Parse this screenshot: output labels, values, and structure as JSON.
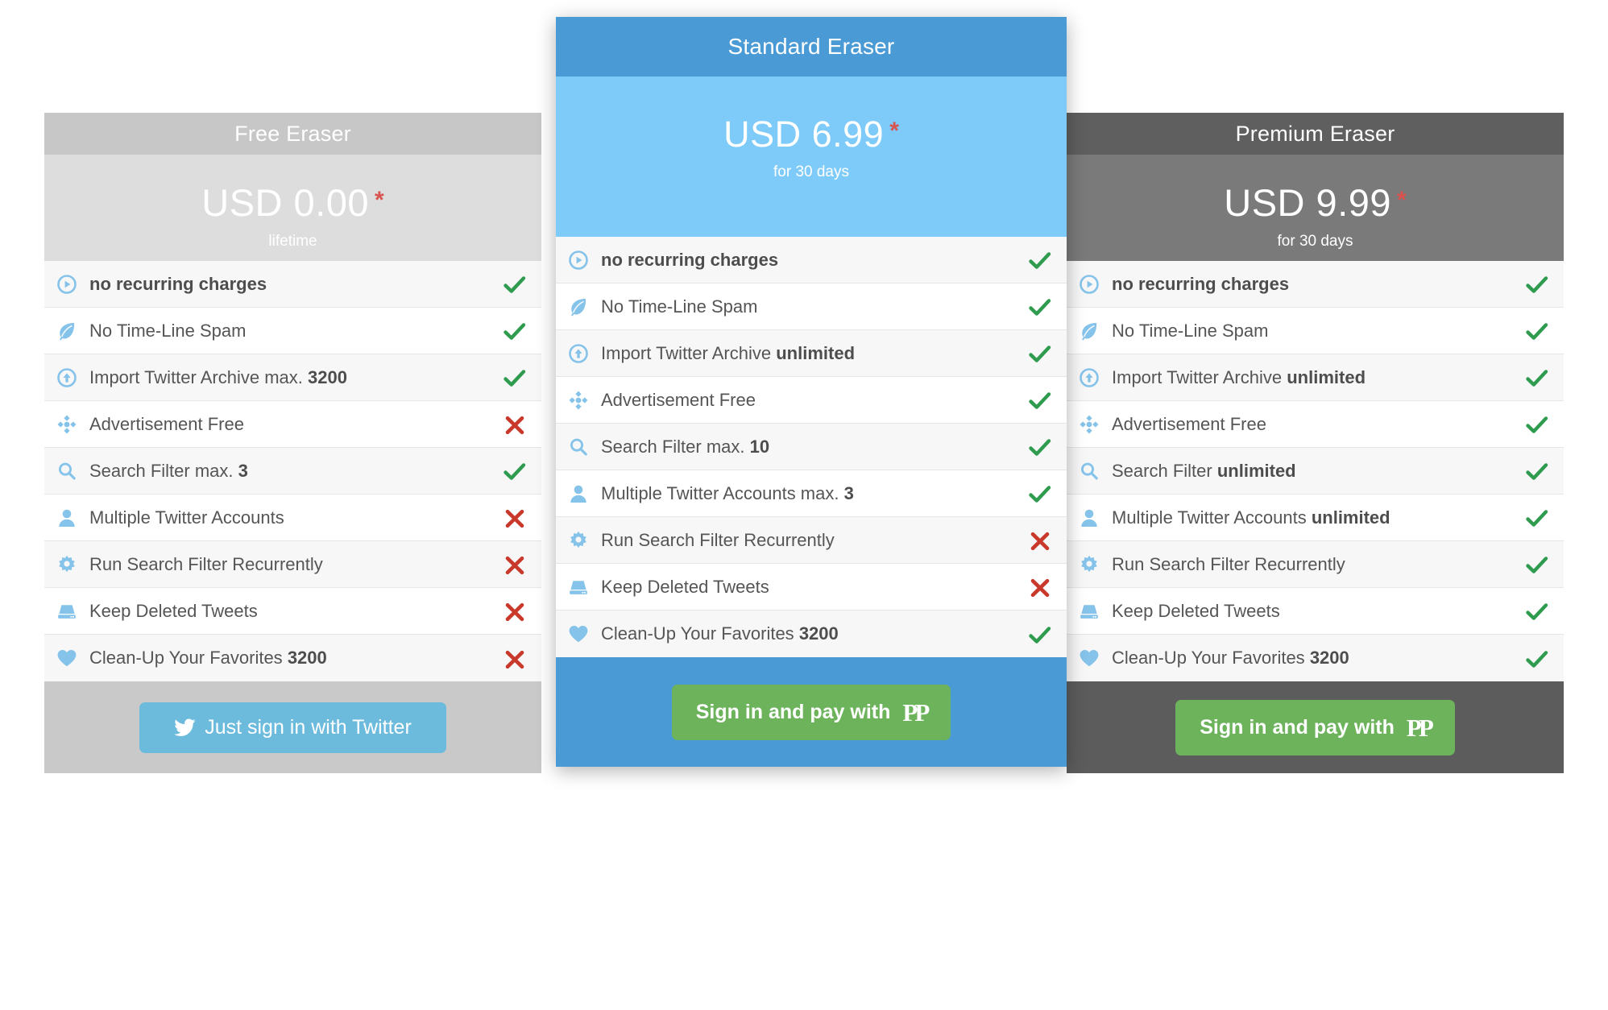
{
  "plans": [
    {
      "id": "free",
      "title": "Free Eraser",
      "price": "USD 0.00",
      "asterisk": "*",
      "period": "lifetime",
      "cta": {
        "label": "Just sign in with Twitter",
        "icon": "twitter-icon",
        "type": "twitter"
      },
      "theme": {
        "title_bg": "#c7c7c7",
        "price_bg": "#dddddd",
        "footer_bg": "#c9c9c9",
        "button_bg": "#6cbbdd"
      },
      "features": [
        {
          "icon": "play-circle-icon",
          "label": "no recurring charges",
          "value": "",
          "bold_label": true,
          "mark": "check"
        },
        {
          "icon": "leaf-icon",
          "label": "No Time-Line Spam",
          "value": "",
          "bold_label": false,
          "mark": "check"
        },
        {
          "icon": "arrow-up-circle-icon",
          "label": "Import Twitter Archive max.",
          "value": "3200",
          "bold_label": false,
          "mark": "check"
        },
        {
          "icon": "move-crosshair-icon",
          "label": "Advertisement Free",
          "value": "",
          "bold_label": false,
          "mark": "cross"
        },
        {
          "icon": "search-icon",
          "label": "Search Filter max.",
          "value": "3",
          "bold_label": false,
          "mark": "check"
        },
        {
          "icon": "user-icon",
          "label": "Multiple Twitter Accounts",
          "value": "",
          "bold_label": false,
          "mark": "cross"
        },
        {
          "icon": "gear-icon",
          "label": "Run Search Filter Recurrently",
          "value": "",
          "bold_label": false,
          "mark": "cross"
        },
        {
          "icon": "hard-drive-icon",
          "label": "Keep Deleted Tweets",
          "value": "",
          "bold_label": false,
          "mark": "cross"
        },
        {
          "icon": "heart-icon",
          "label": "Clean-Up Your Favorites",
          "value": "3200",
          "bold_label": false,
          "mark": "cross"
        }
      ]
    },
    {
      "id": "standard",
      "title": "Standard Eraser",
      "price": "USD 6.99",
      "asterisk": "*",
      "period": "for 30 days",
      "cta": {
        "label": "Sign in and pay with",
        "icon": "paypal-icon",
        "type": "paypal"
      },
      "theme": {
        "title_bg": "#4a9ad5",
        "price_bg": "#7ecbf9",
        "footer_bg": "#4a9ad5",
        "button_bg": "#6cb35c"
      },
      "features": [
        {
          "icon": "play-circle-icon",
          "label": "no recurring charges",
          "value": "",
          "bold_label": true,
          "mark": "check"
        },
        {
          "icon": "leaf-icon",
          "label": "No Time-Line Spam",
          "value": "",
          "bold_label": false,
          "mark": "check"
        },
        {
          "icon": "arrow-up-circle-icon",
          "label": "Import Twitter Archive",
          "value": "unlimited",
          "bold_label": false,
          "mark": "check"
        },
        {
          "icon": "move-crosshair-icon",
          "label": "Advertisement Free",
          "value": "",
          "bold_label": false,
          "mark": "check"
        },
        {
          "icon": "search-icon",
          "label": "Search Filter max.",
          "value": "10",
          "bold_label": false,
          "mark": "check"
        },
        {
          "icon": "user-icon",
          "label": "Multiple Twitter Accounts max.",
          "value": "3",
          "bold_label": false,
          "mark": "check"
        },
        {
          "icon": "gear-icon",
          "label": "Run Search Filter Recurrently",
          "value": "",
          "bold_label": false,
          "mark": "cross"
        },
        {
          "icon": "hard-drive-icon",
          "label": "Keep Deleted Tweets",
          "value": "",
          "bold_label": false,
          "mark": "cross"
        },
        {
          "icon": "heart-icon",
          "label": "Clean-Up Your Favorites",
          "value": "3200",
          "bold_label": false,
          "mark": "check"
        }
      ]
    },
    {
      "id": "premium",
      "title": "Premium Eraser",
      "price": "USD 9.99",
      "asterisk": "*",
      "period": "for 30 days",
      "cta": {
        "label": "Sign in and pay with",
        "icon": "paypal-icon",
        "type": "paypal"
      },
      "theme": {
        "title_bg": "#5f5f5f",
        "price_bg": "#7a7a7a",
        "footer_bg": "#5c5c5c",
        "button_bg": "#6cb35c"
      },
      "features": [
        {
          "icon": "play-circle-icon",
          "label": "no recurring charges",
          "value": "",
          "bold_label": true,
          "mark": "check"
        },
        {
          "icon": "leaf-icon",
          "label": "No Time-Line Spam",
          "value": "",
          "bold_label": false,
          "mark": "check"
        },
        {
          "icon": "arrow-up-circle-icon",
          "label": "Import Twitter Archive",
          "value": "unlimited",
          "bold_label": false,
          "mark": "check"
        },
        {
          "icon": "move-crosshair-icon",
          "label": "Advertisement Free",
          "value": "",
          "bold_label": false,
          "mark": "check"
        },
        {
          "icon": "search-icon",
          "label": "Search Filter",
          "value": "unlimited",
          "bold_label": false,
          "mark": "check"
        },
        {
          "icon": "user-icon",
          "label": "Multiple Twitter Accounts",
          "value": "unlimited",
          "bold_label": false,
          "mark": "check"
        },
        {
          "icon": "gear-icon",
          "label": "Run Search Filter Recurrently",
          "value": "",
          "bold_label": false,
          "mark": "check"
        },
        {
          "icon": "hard-drive-icon",
          "label": "Keep Deleted Tweets",
          "value": "",
          "bold_label": false,
          "mark": "check"
        },
        {
          "icon": "heart-icon",
          "label": "Clean-Up Your Favorites",
          "value": "3200",
          "bold_label": false,
          "mark": "check"
        }
      ]
    }
  ],
  "colors": {
    "check_green": "#2e9b4e",
    "cross_red": "#c9392b",
    "asterisk_red": "#d9534f",
    "icon_blue": "#85c3ea",
    "twitter_blue": "#6cbbdd",
    "paypal_green": "#6cb35c",
    "accent_blue": "#4a9ad5"
  }
}
